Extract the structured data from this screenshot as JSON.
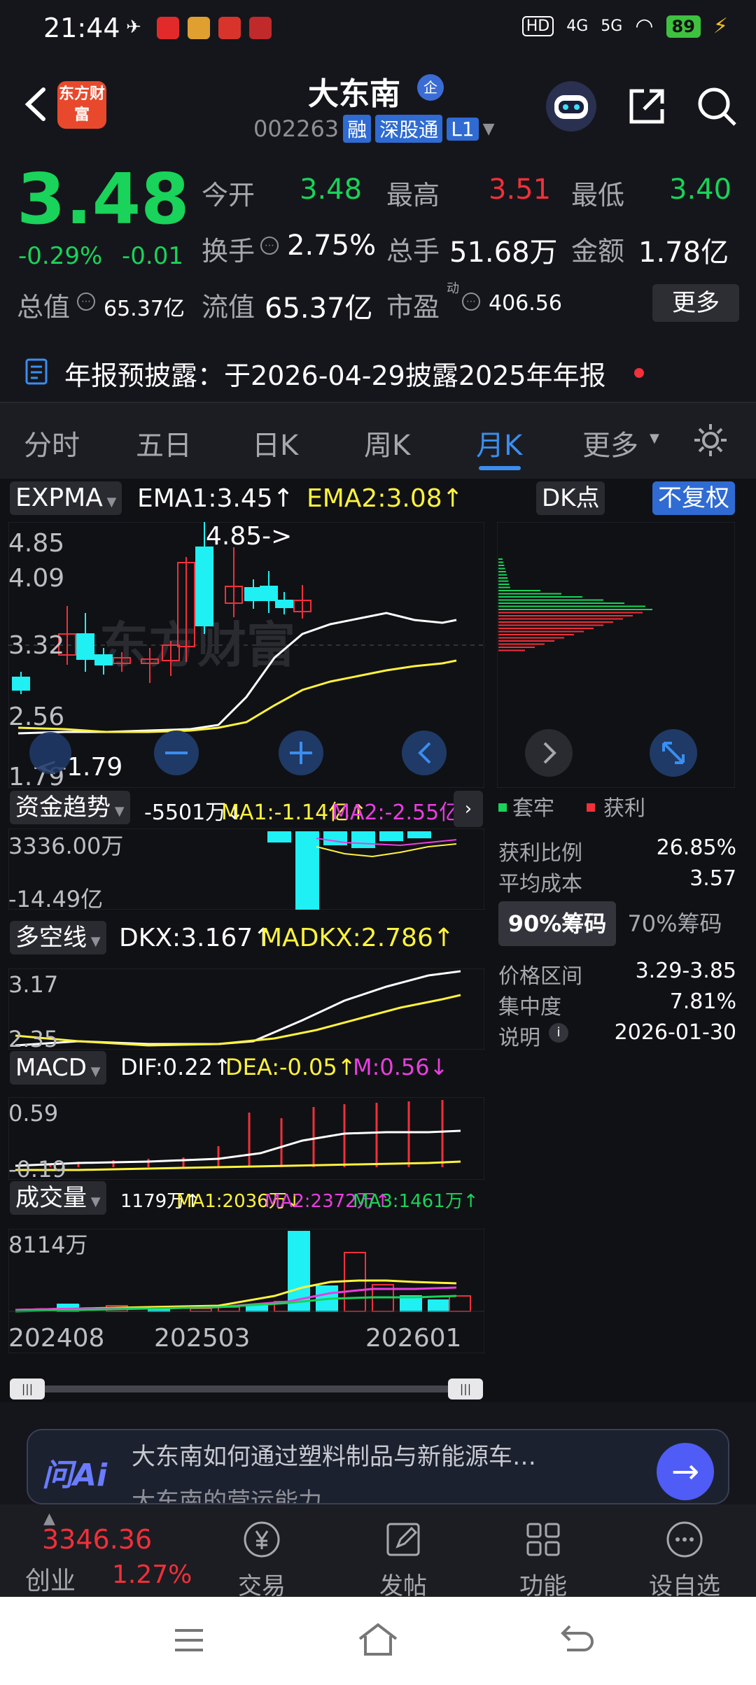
{
  "status_bar": {
    "time": "21:44",
    "network": "4G",
    "network2": "5G",
    "hd": "HD",
    "battery": "89"
  },
  "header": {
    "logo_text": "东方财富",
    "stock_name": "大东南",
    "corp_badge": "企",
    "stock_code": "002263",
    "tag_margin": "融",
    "tag_connect": "深股通",
    "tag_level": "L1"
  },
  "quote": {
    "price": "3.48",
    "change_pct": "-0.29%",
    "change_abs": "-0.01",
    "rows": [
      [
        {
          "label": "今开",
          "value": "3.48",
          "color": "green"
        },
        {
          "label": "最高",
          "value": "3.51",
          "color": "red"
        },
        {
          "label": "最低",
          "value": "3.40",
          "color": "green"
        }
      ],
      [
        {
          "label": "换手",
          "value": "2.75%",
          "color": "white"
        },
        {
          "label": "总手",
          "value": "51.68万",
          "color": "white"
        },
        {
          "label": "金额",
          "value": "1.78亿",
          "color": "white"
        }
      ],
      [
        {
          "label": "总值",
          "value": "65.37亿",
          "color": "white"
        },
        {
          "label": "流值",
          "value": "65.37亿",
          "color": "white"
        },
        {
          "label": "市盈",
          "value": "406.56",
          "color": "white"
        }
      ]
    ],
    "pe_super": "动",
    "more_label": "更多"
  },
  "notice": {
    "text": "年报预披露：于2026-04-29披露2025年年报"
  },
  "tabs": [
    "分时",
    "五日",
    "日K",
    "周K",
    "月K",
    "更多"
  ],
  "active_tab": "月K",
  "main_chart": {
    "indicator": "EXPMA",
    "ema1": "EMA1:3.45↑",
    "ema2": "EMA2:3.08↑",
    "dk_label": "DK点",
    "fq_label": "不复权",
    "y_labels": [
      "4.85",
      "4.09",
      "3.32",
      "2.56",
      "1.79"
    ],
    "high_marker": "4.85->",
    "low_marker": "<-1.79",
    "watermark": "东方财富"
  },
  "fund": {
    "indicator": "资金趋势",
    "value": "-5501万↓",
    "ma1": "MA1:-1.14亿↑",
    "ma2": "MA2:-2.55亿↓",
    "y_top": "3336.00万",
    "y_bottom": "-14.49亿"
  },
  "dkx": {
    "indicator": "多空线",
    "dkx": "DKX:3.167↑",
    "madkx": "MADKX:2.786↑",
    "y_top": "3.17",
    "y_bottom": "2.35"
  },
  "macd": {
    "indicator": "MACD",
    "dif": "DIF:0.22↑",
    "dea": "DEA:-0.05↑",
    "m": "M:0.56↓",
    "y_top": "0.59",
    "y_bottom": "-0.19"
  },
  "volume": {
    "indicator": "成交量",
    "vol": "1179万↑",
    "ma1": "MA1:2036万↓",
    "ma2": "MA2:2372万↑",
    "ma3": "MA3:1461万↑",
    "y_top": "8114万",
    "x_labels": [
      "202408",
      "202503",
      "202601"
    ]
  },
  "chips": {
    "legend_trapped": "套牢",
    "legend_profit": "获利",
    "rows1": [
      {
        "label": "获利比例",
        "value": "26.85%"
      },
      {
        "label": "平均成本",
        "value": "3.57"
      }
    ],
    "tab_90": "90%筹码",
    "tab_70": "70%筹码",
    "rows2": [
      {
        "label": "价格区间",
        "value": "3.29-3.85"
      },
      {
        "label": "集中度",
        "value": "7.81%"
      },
      {
        "label": "说明",
        "value": "2026-01-30"
      }
    ]
  },
  "ask": {
    "logo": "问Ai",
    "line1": "大东南如何通过塑料制品与新能源车…",
    "line2": "大东南的营运能力"
  },
  "bottom_nav": {
    "index_value": "3346.36",
    "index_name": "创业",
    "index_change": "1.27%",
    "items": [
      "交易",
      "发帖",
      "功能",
      "设自选"
    ]
  },
  "colors": {
    "up": "#f0303a",
    "down": "#19d35a",
    "accent": "#3a8ef0",
    "cyan": "#1ef0f4",
    "yellow": "#fff33d",
    "magenta": "#e83fe0"
  }
}
